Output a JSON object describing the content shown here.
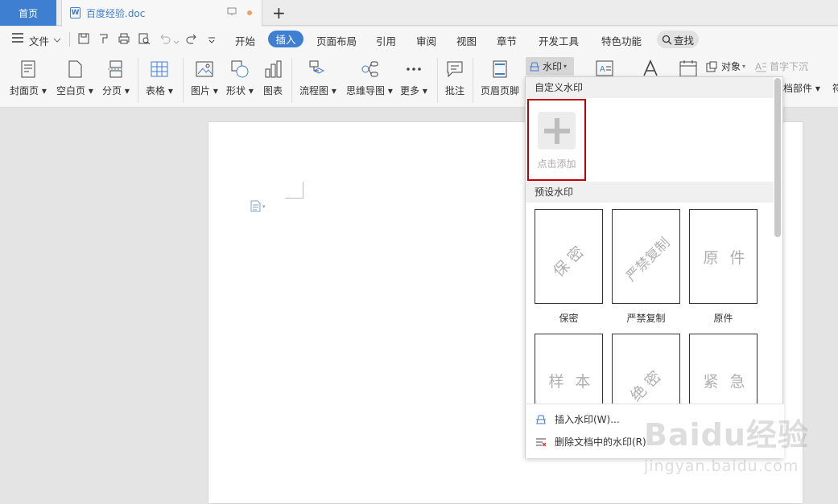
{
  "tabs": {
    "home": "首页",
    "doc_name": "百度经验.doc",
    "new": "+"
  },
  "menu": {
    "file": "文件",
    "items": [
      "开始",
      "插入",
      "页面布局",
      "引用",
      "审阅",
      "视图",
      "章节",
      "开发工具",
      "特色功能"
    ],
    "active": "插入",
    "search": "查找"
  },
  "ribbon": {
    "cover": "封面页",
    "blank": "空白页",
    "pagebreak": "分页",
    "table": "表格",
    "picture": "图片",
    "shape": "形状",
    "chart": "图表",
    "flow": "流程图",
    "mindmap": "思维导图",
    "more": "更多",
    "comment": "批注",
    "headerfooter": "页眉页脚",
    "watermark": "水印",
    "object": "对象",
    "dropcap": "首字下沉",
    "docpart": "档部件",
    "extra": "符"
  },
  "watermark_menu": {
    "custom_title": "自定义水印",
    "add_label": "点击添加",
    "preset_title": "预设水印",
    "presets": [
      {
        "text": "保密",
        "label": "保密"
      },
      {
        "text": "严禁复制",
        "label": "严禁复制"
      },
      {
        "text": "原件",
        "label": "原件"
      },
      {
        "text": "样本",
        "label": ""
      },
      {
        "text": "绝密",
        "label": ""
      },
      {
        "text": "紧急",
        "label": ""
      }
    ],
    "insert": "插入水印(W)...",
    "delete": "删除文档中的水印(R)"
  },
  "watermark_brand": {
    "logo": "Baidu经验",
    "url": "jingyan.baidu.com"
  },
  "colors": {
    "accent": "#3f7fd2",
    "highlight": "#c00000"
  }
}
